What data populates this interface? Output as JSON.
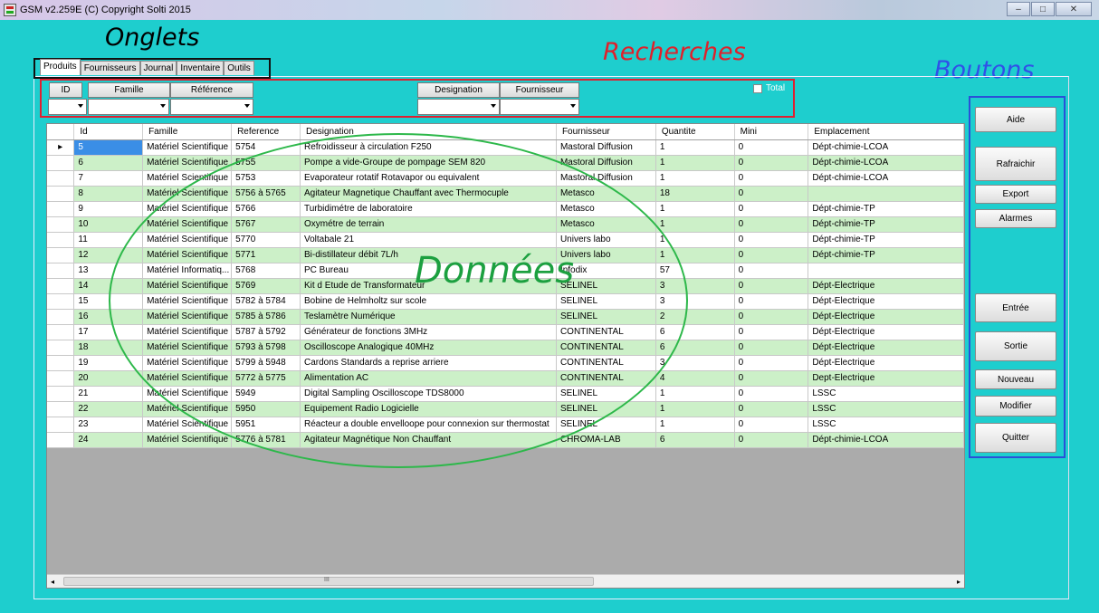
{
  "window": {
    "title": "GSM v2.259E (C) Copyright Solti 2015",
    "min": "–",
    "max": "□",
    "close": "✕"
  },
  "annotations": {
    "onglets": "Onglets",
    "recherches": "Recherches",
    "boutons": "Boutons",
    "donnees": "Données"
  },
  "tabs": [
    "Produits",
    "Fournisseurs",
    "Journal",
    "Inventaire",
    "Outils"
  ],
  "search": {
    "id": "ID",
    "famille": "Famille",
    "reference": "Référence",
    "designation": "Designation",
    "fournisseur": "Fournisseur",
    "total": "Total"
  },
  "grid": {
    "columns": [
      "Id",
      "Famille",
      "Reference",
      "Designation",
      "Fournisseur",
      "Quantite",
      "Mini",
      "Emplacement"
    ],
    "rows": [
      [
        "5",
        "Matériel Scientifique",
        "5754",
        "Refroidisseur à circulation F250",
        "Mastoral Diffusion",
        "1",
        "0",
        "Dépt-chimie-LCOA"
      ],
      [
        "6",
        "Matériel Scientifique",
        "5755",
        "Pompe a vide-Groupe de pompage SEM 820",
        "Mastoral Diffusion",
        "1",
        "0",
        "Dépt-chimie-LCOA"
      ],
      [
        "7",
        "Matériel Scientifique",
        "5753",
        "Evaporateur rotatif Rotavapor ou equivalent",
        "Mastoral Diffusion",
        "1",
        "0",
        "Dépt-chimie-LCOA"
      ],
      [
        "8",
        "Matériel Scientifique",
        "5756 à 5765",
        "Agitateur Magnetique Chauffant avec Thermocuple",
        "Metasco",
        "18",
        "0",
        ""
      ],
      [
        "9",
        "Matériel Scientifique",
        "5766",
        "Turbidimétre de laboratoire",
        "Metasco",
        "1",
        "0",
        "Dépt-chimie-TP"
      ],
      [
        "10",
        "Matériel Scientifique",
        "5767",
        "Oxymétre de terrain",
        "Metasco",
        "1",
        "0",
        "Dépt-chimie-TP"
      ],
      [
        "11",
        "Matériel Scientifique",
        "5770",
        "Voltabale 21",
        "Univers labo",
        "1",
        "0",
        "Dépt-chimie-TP"
      ],
      [
        "12",
        "Matériel Scientifique",
        "5771",
        "Bi-distillateur débit 7L/h",
        "Univers labo",
        "1",
        "0",
        "Dépt-chimie-TP"
      ],
      [
        "13",
        "Matériel Informatiq...",
        "5768",
        "PC Bureau",
        "Infodix",
        "57",
        "0",
        ""
      ],
      [
        "14",
        "Matériel Scientifique",
        "5769",
        "Kit d Etude de Transformateur",
        "SELINEL",
        "3",
        "0",
        "Dépt-Electrique"
      ],
      [
        "15",
        "Matériel Scientifique",
        "5782 à 5784",
        "Bobine de Helmholtz sur scole",
        "SELINEL",
        "3",
        "0",
        "Dépt-Electrique"
      ],
      [
        "16",
        "Matériel Scientifique",
        "5785 à 5786",
        "Teslamètre Numérique",
        "SELINEL",
        "2",
        "0",
        "Dépt-Electrique"
      ],
      [
        "17",
        "Matériel Scientifique",
        "5787 à 5792",
        "Générateur de fonctions 3MHz",
        "CONTINENTAL",
        "6",
        "0",
        "Dépt-Electrique"
      ],
      [
        "18",
        "Matériel Scientifique",
        "5793 à 5798",
        "Oscilloscope Analogique 40MHz",
        "CONTINENTAL",
        "6",
        "0",
        "Dépt-Electrique"
      ],
      [
        "19",
        "Matériel Scientifique",
        "5799 à 5948",
        "Cardons Standards a reprise arriere",
        "CONTINENTAL",
        "3",
        "0",
        "Dépt-Electrique"
      ],
      [
        "20",
        "Matériel Scientifique",
        "5772 à 5775",
        "Alimentation AC",
        "CONTINENTAL",
        "4",
        "0",
        "Dept-Electrique"
      ],
      [
        "21",
        "Matériel Scientifique",
        "5949",
        "Digital Sampling Oscilloscope TDS8000",
        "SELINEL",
        "1",
        "0",
        "LSSC"
      ],
      [
        "22",
        "Matériel Scientifique",
        "5950",
        "Equipement Radio Logicielle",
        "SELINEL",
        "1",
        "0",
        "LSSC"
      ],
      [
        "23",
        "Matériel Scientifique",
        "5951",
        "Réacteur a double envelloope pour connexion sur thermostat",
        "SELINEL",
        "1",
        "0",
        "LSSC"
      ],
      [
        "24",
        "Matériel Scientifique",
        "5776 à 5781",
        "Agitateur Magnétique Non Chauffant",
        "CHROMA-LAB",
        "6",
        "0",
        "Dépt-chimie-LCOA"
      ]
    ],
    "scroll_grip": "III",
    "scroll_left": "◂",
    "scroll_right": "▸",
    "row_marker": "▸"
  },
  "buttons": {
    "aide": "Aide",
    "rafraichir": "Rafraichir",
    "export": "Export",
    "alarmes": "Alarmes",
    "entree": "Entrée",
    "sortie": "Sortie",
    "nouveau": "Nouveau",
    "modifier": "Modifier",
    "quitter": "Quitter"
  },
  "colors": {
    "background": "#1ecece",
    "row_alt": "#ccf0c8",
    "recherches_border": "#e02030",
    "boutons_border": "#2a50d8",
    "ellipse": "#2db84a"
  }
}
